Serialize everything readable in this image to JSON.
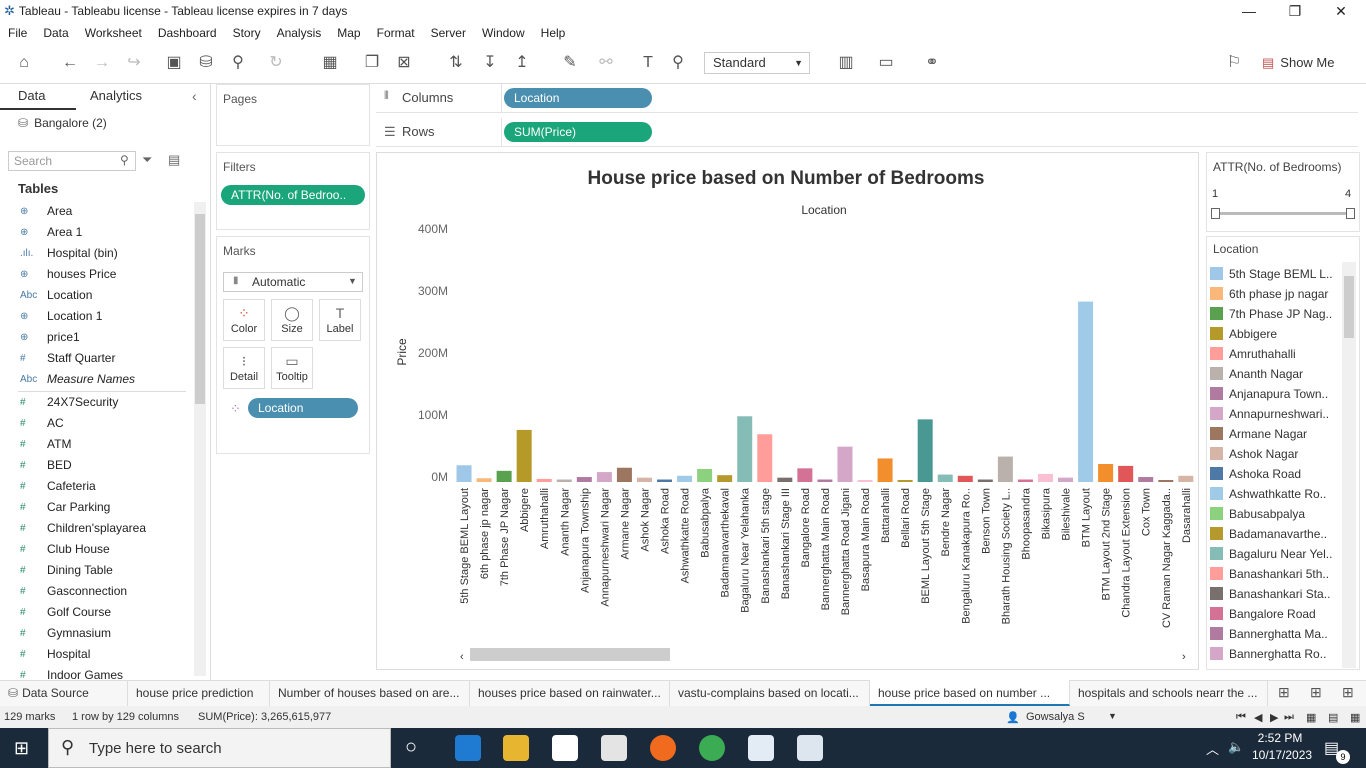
{
  "window": {
    "title": "Tableau - Tableabu license - Tableau license expires in 7 days",
    "minimize": "—",
    "restore": "❐",
    "close": "✕"
  },
  "menu": [
    "File",
    "Data",
    "Worksheet",
    "Dashboard",
    "Story",
    "Analysis",
    "Map",
    "Format",
    "Server",
    "Window",
    "Help"
  ],
  "toolbar": {
    "fit": "Standard",
    "show_me": "Show Me"
  },
  "data_pane": {
    "tab_data": "Data",
    "tab_analytics": "Analytics",
    "datasource": "Bangalore (2)",
    "search_placeholder": "Search",
    "tables_heading": "Tables",
    "dimensions": [
      {
        "icon": "⊕",
        "label": "Area"
      },
      {
        "icon": "⊕",
        "label": "Area 1"
      },
      {
        "icon": ".ılı.",
        "label": "Hospital (bin)"
      },
      {
        "icon": "⊕",
        "label": "houses Price"
      },
      {
        "icon": "Abc",
        "label": "Location"
      },
      {
        "icon": "⊕",
        "label": "Location 1"
      },
      {
        "icon": "⊕",
        "label": "price1"
      },
      {
        "icon": "#",
        "label": "Staff Quarter"
      },
      {
        "icon": "Abc",
        "label": "Measure Names"
      }
    ],
    "measures": [
      {
        "icon": "#",
        "label": "24X7Security"
      },
      {
        "icon": "#",
        "label": "AC"
      },
      {
        "icon": "#",
        "label": "ATM"
      },
      {
        "icon": "#",
        "label": "BED"
      },
      {
        "icon": "#",
        "label": "Cafeteria"
      },
      {
        "icon": "#",
        "label": "Car Parking"
      },
      {
        "icon": "#",
        "label": "Children'splayarea"
      },
      {
        "icon": "#",
        "label": "Club House"
      },
      {
        "icon": "#",
        "label": "Dining Table"
      },
      {
        "icon": "#",
        "label": "Gasconnection"
      },
      {
        "icon": "#",
        "label": "Golf Course"
      },
      {
        "icon": "#",
        "label": "Gymnasium"
      },
      {
        "icon": "#",
        "label": "Hospital"
      },
      {
        "icon": "#",
        "label": "Indoor Games"
      }
    ]
  },
  "shelves": {
    "pages": "Pages",
    "filters": "Filters",
    "filter_pill": "ATTR(No. of Bedroo..",
    "marks": "Marks",
    "mark_type": "Automatic",
    "mark_buttons": [
      "Color",
      "Size",
      "Label",
      "Detail",
      "Tooltip"
    ],
    "color_pill": "Location",
    "columns": "Columns",
    "columns_pill": "Location",
    "rows": "Rows",
    "rows_pill": "SUM(Price)"
  },
  "chart_data": {
    "type": "bar",
    "title": "House price based on Number of Bedrooms",
    "header": "Location",
    "ylabel": "Price",
    "yticks": [
      "0M",
      "100M",
      "200M",
      "300M",
      "400M"
    ],
    "ylim": [
      0,
      400
    ],
    "unit": "M",
    "categories": [
      "5th Stage BEML Layout",
      "6th phase jp nagar",
      "7th Phase JP Nagar",
      "Abbigere",
      "Amruthahalli",
      "Ananth Nagar",
      "Anjanapura Township",
      "Annapurneshwari Nagar",
      "Armane Nagar",
      "Ashok Nagar",
      "Ashoka Road",
      "Ashwathkatte Road",
      "Babusabpalya",
      "Badamanavarthekaval",
      "Bagaluru Near Yelahanka",
      "Banashankari 5th stage",
      "Banashankari Stage III",
      "Bangalore Road",
      "Bannerghatta Main Road",
      "Bannerghatta Road Jigani",
      "Basapura Main Road",
      "Battarahalli",
      "Bellari Road",
      "BEML Layout 5th Stage",
      "Bendre Nagar",
      "Bengaluru Kanakapura Ro..",
      "Benson Town",
      "Bharath Housing Society L..",
      "Bhoopasandra",
      "Bikasipura",
      "Bileshivale",
      "BTM Layout",
      "BTM Layout 2nd Stage",
      "Chandra Layout Extension",
      "Cox Town",
      "CV Raman Nagar Kaggada..",
      "Dasarahalli"
    ],
    "values": [
      27,
      6,
      18,
      84,
      5,
      4,
      8,
      16,
      23,
      7,
      4,
      10,
      21,
      11,
      106,
      77,
      7,
      22,
      4,
      57,
      3,
      38,
      3,
      101,
      12,
      10,
      4,
      41,
      4,
      13,
      7,
      291,
      29,
      26,
      8,
      3,
      10
    ],
    "colors": [
      "#9fc8e8",
      "#f9b77a",
      "#59a14f",
      "#b69a29",
      "#ff9d9a",
      "#bab0ac",
      "#b07aa1",
      "#d4a6c8",
      "#9d7660",
      "#d7b5a6",
      "#4e79a7",
      "#a0cbe8",
      "#8cd17d",
      "#b6992d",
      "#86bcb6",
      "#ff9d9a",
      "#79706e",
      "#d37295",
      "#b07aa1",
      "#d4a6c8",
      "#fabfd2",
      "#f28e2b",
      "#b6992d",
      "#499894",
      "#86bcb6",
      "#e15759",
      "#79706e",
      "#bab0ac",
      "#d37295",
      "#fabfd2",
      "#d4a6c8",
      "#a0cbe8",
      "#f28e2b",
      "#e15759",
      "#b07aa1",
      "#9d7660",
      "#d7b5a6"
    ]
  },
  "attr_filter": {
    "title": "ATTR(No. of Bedrooms)",
    "min": "1",
    "max": "4"
  },
  "legend": {
    "title": "Location",
    "items": [
      {
        "label": "5th Stage BEML L..",
        "color": "#9fc8e8"
      },
      {
        "label": "6th phase jp nagar",
        "color": "#f9b77a"
      },
      {
        "label": "7th Phase JP Nag..",
        "color": "#59a14f"
      },
      {
        "label": "Abbigere",
        "color": "#b69a29"
      },
      {
        "label": "Amruthahalli",
        "color": "#ff9d9a"
      },
      {
        "label": "Ananth Nagar",
        "color": "#bab0ac"
      },
      {
        "label": "Anjanapura Town..",
        "color": "#b07aa1"
      },
      {
        "label": "Annapurneshwari..",
        "color": "#d4a6c8"
      },
      {
        "label": "Armane Nagar",
        "color": "#9d7660"
      },
      {
        "label": "Ashok Nagar",
        "color": "#d7b5a6"
      },
      {
        "label": "Ashoka Road",
        "color": "#4e79a7"
      },
      {
        "label": "Ashwathkatte Ro..",
        "color": "#a0cbe8"
      },
      {
        "label": "Babusabpalya",
        "color": "#8cd17d"
      },
      {
        "label": "Badamanavarthe..",
        "color": "#b6992d"
      },
      {
        "label": "Bagaluru Near Yel..",
        "color": "#86bcb6"
      },
      {
        "label": "Banashankari 5th..",
        "color": "#ff9d9a"
      },
      {
        "label": "Banashankari Sta..",
        "color": "#79706e"
      },
      {
        "label": "Bangalore Road",
        "color": "#d37295"
      },
      {
        "label": "Bannerghatta Ma..",
        "color": "#b07aa1"
      },
      {
        "label": "Bannerghatta Ro..",
        "color": "#d4a6c8"
      }
    ]
  },
  "sheet_tabs": {
    "data_source": "Data Source",
    "tabs": [
      "house price prediction",
      "Number of houses based on are...",
      "houses price based on rainwater...",
      "vastu-complains based on locati...",
      "house price based on number ...",
      "hospitals and schools nearr the ..."
    ],
    "active": 4
  },
  "status": {
    "marks": "129 marks",
    "dims": "1 row by 129 columns",
    "sum": "SUM(Price): 3,265,615,977",
    "user": "Gowsalya S"
  },
  "taskbar": {
    "search_placeholder": "Type here to search",
    "time": "2:52 PM",
    "date": "10/17/2023",
    "notifications": "9"
  }
}
